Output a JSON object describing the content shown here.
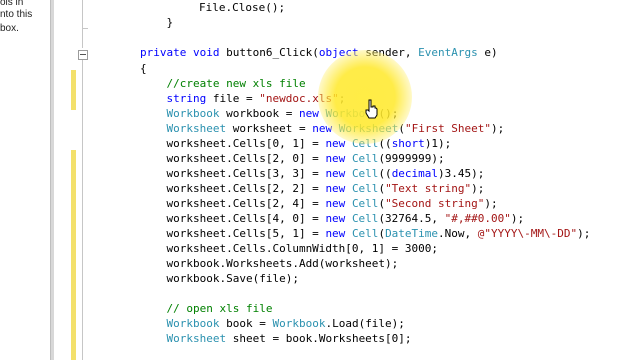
{
  "left_panel": {
    "lines": [
      "ols in",
      "nto this",
      "box."
    ]
  },
  "code_lines": [
    [
      {
        "t": "        File.Close();",
        "c": "pl"
      }
    ],
    [
      {
        "t": "    }",
        "c": "pl"
      }
    ],
    [
      {
        "t": "",
        "c": "pl"
      }
    ],
    [
      {
        "t": "private ",
        "c": "kw"
      },
      {
        "t": "void ",
        "c": "kw"
      },
      {
        "t": "button6_Click(",
        "c": "pl"
      },
      {
        "t": "object ",
        "c": "kw"
      },
      {
        "t": "sender, ",
        "c": "pl"
      },
      {
        "t": "EventArgs ",
        "c": "ty"
      },
      {
        "t": "e)",
        "c": "pl"
      }
    ],
    [
      {
        "t": "{",
        "c": "pl"
      }
    ],
    [
      {
        "t": "    //create new xls file",
        "c": "cm"
      }
    ],
    [
      {
        "t": "    ",
        "c": "pl"
      },
      {
        "t": "string ",
        "c": "kw"
      },
      {
        "t": "file = ",
        "c": "pl"
      },
      {
        "t": "\"newdoc.xls\"",
        "c": "str"
      },
      {
        "t": ";",
        "c": "pl"
      }
    ],
    [
      {
        "t": "    ",
        "c": "pl"
      },
      {
        "t": "Workbook ",
        "c": "ty"
      },
      {
        "t": "workbook = ",
        "c": "pl"
      },
      {
        "t": "new ",
        "c": "kw"
      },
      {
        "t": "Workbook",
        "c": "ty"
      },
      {
        "t": "();",
        "c": "pl"
      }
    ],
    [
      {
        "t": "    ",
        "c": "pl"
      },
      {
        "t": "Worksheet ",
        "c": "ty"
      },
      {
        "t": "worksheet = ",
        "c": "pl"
      },
      {
        "t": "new ",
        "c": "kw"
      },
      {
        "t": "Worksheet",
        "c": "ty"
      },
      {
        "t": "(",
        "c": "pl"
      },
      {
        "t": "\"First Sheet\"",
        "c": "str"
      },
      {
        "t": ");",
        "c": "pl"
      }
    ],
    [
      {
        "t": "    worksheet.Cells[0, 1] = ",
        "c": "pl"
      },
      {
        "t": "new ",
        "c": "kw"
      },
      {
        "t": "Cell",
        "c": "ty"
      },
      {
        "t": "((",
        "c": "pl"
      },
      {
        "t": "short",
        "c": "kw"
      },
      {
        "t": ")1);",
        "c": "pl"
      }
    ],
    [
      {
        "t": "    worksheet.Cells[2, 0] = ",
        "c": "pl"
      },
      {
        "t": "new ",
        "c": "kw"
      },
      {
        "t": "Cell",
        "c": "ty"
      },
      {
        "t": "(9999999);",
        "c": "pl"
      }
    ],
    [
      {
        "t": "    worksheet.Cells[3, 3] = ",
        "c": "pl"
      },
      {
        "t": "new ",
        "c": "kw"
      },
      {
        "t": "Cell",
        "c": "ty"
      },
      {
        "t": "((",
        "c": "pl"
      },
      {
        "t": "decimal",
        "c": "kw"
      },
      {
        "t": ")3.45);",
        "c": "pl"
      }
    ],
    [
      {
        "t": "    worksheet.Cells[2, 2] = ",
        "c": "pl"
      },
      {
        "t": "new ",
        "c": "kw"
      },
      {
        "t": "Cell",
        "c": "ty"
      },
      {
        "t": "(",
        "c": "pl"
      },
      {
        "t": "\"Text string\"",
        "c": "str"
      },
      {
        "t": ");",
        "c": "pl"
      }
    ],
    [
      {
        "t": "    worksheet.Cells[2, 4] = ",
        "c": "pl"
      },
      {
        "t": "new ",
        "c": "kw"
      },
      {
        "t": "Cell",
        "c": "ty"
      },
      {
        "t": "(",
        "c": "pl"
      },
      {
        "t": "\"Second string\"",
        "c": "str"
      },
      {
        "t": ");",
        "c": "pl"
      }
    ],
    [
      {
        "t": "    worksheet.Cells[4, 0] = ",
        "c": "pl"
      },
      {
        "t": "new ",
        "c": "kw"
      },
      {
        "t": "Cell",
        "c": "ty"
      },
      {
        "t": "(32764.5, ",
        "c": "pl"
      },
      {
        "t": "\"#,##0.00\"",
        "c": "str"
      },
      {
        "t": ");",
        "c": "pl"
      }
    ],
    [
      {
        "t": "    worksheet.Cells[5, 1] = ",
        "c": "pl"
      },
      {
        "t": "new ",
        "c": "kw"
      },
      {
        "t": "Cell",
        "c": "ty"
      },
      {
        "t": "(",
        "c": "pl"
      },
      {
        "t": "DateTime",
        "c": "ty"
      },
      {
        "t": ".Now, ",
        "c": "pl"
      },
      {
        "t": "@\"YYYY\\-MM\\-DD\"",
        "c": "str"
      },
      {
        "t": ");",
        "c": "pl"
      }
    ],
    [
      {
        "t": "    worksheet.Cells.ColumnWidth[0, 1] = 3000;",
        "c": "pl"
      }
    ],
    [
      {
        "t": "    workbook.Worksheets.Add(worksheet);",
        "c": "pl"
      }
    ],
    [
      {
        "t": "    workbook.Save(file);",
        "c": "pl"
      }
    ],
    [
      {
        "t": "",
        "c": "pl"
      }
    ],
    [
      {
        "t": "    // open xls file",
        "c": "cm"
      }
    ],
    [
      {
        "t": "    ",
        "c": "pl"
      },
      {
        "t": "Workbook ",
        "c": "ty"
      },
      {
        "t": "book = ",
        "c": "pl"
      },
      {
        "t": "Workbook",
        "c": "ty"
      },
      {
        "t": ".Load(file);",
        "c": "pl"
      }
    ],
    [
      {
        "t": "    ",
        "c": "pl"
      },
      {
        "t": "Worksheet ",
        "c": "ty"
      },
      {
        "t": "sheet = book.Worksheets[0];",
        "c": "pl"
      }
    ]
  ]
}
